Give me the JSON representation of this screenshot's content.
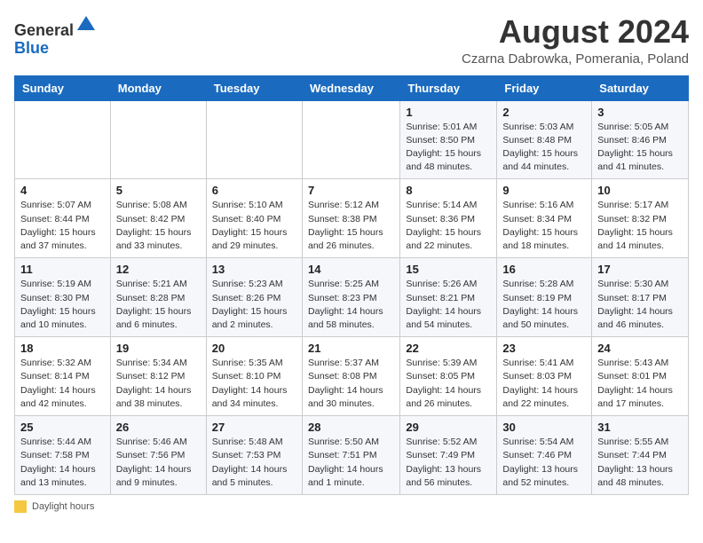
{
  "header": {
    "logo_line1": "General",
    "logo_line2": "Blue",
    "title": "August 2024",
    "subtitle": "Czarna Dabrowka, Pomerania, Poland"
  },
  "days_of_week": [
    "Sunday",
    "Monday",
    "Tuesday",
    "Wednesday",
    "Thursday",
    "Friday",
    "Saturday"
  ],
  "weeks": [
    [
      {
        "day": "",
        "info": ""
      },
      {
        "day": "",
        "info": ""
      },
      {
        "day": "",
        "info": ""
      },
      {
        "day": "",
        "info": ""
      },
      {
        "day": "1",
        "info": "Sunrise: 5:01 AM\nSunset: 8:50 PM\nDaylight: 15 hours\nand 48 minutes."
      },
      {
        "day": "2",
        "info": "Sunrise: 5:03 AM\nSunset: 8:48 PM\nDaylight: 15 hours\nand 44 minutes."
      },
      {
        "day": "3",
        "info": "Sunrise: 5:05 AM\nSunset: 8:46 PM\nDaylight: 15 hours\nand 41 minutes."
      }
    ],
    [
      {
        "day": "4",
        "info": "Sunrise: 5:07 AM\nSunset: 8:44 PM\nDaylight: 15 hours\nand 37 minutes."
      },
      {
        "day": "5",
        "info": "Sunrise: 5:08 AM\nSunset: 8:42 PM\nDaylight: 15 hours\nand 33 minutes."
      },
      {
        "day": "6",
        "info": "Sunrise: 5:10 AM\nSunset: 8:40 PM\nDaylight: 15 hours\nand 29 minutes."
      },
      {
        "day": "7",
        "info": "Sunrise: 5:12 AM\nSunset: 8:38 PM\nDaylight: 15 hours\nand 26 minutes."
      },
      {
        "day": "8",
        "info": "Sunrise: 5:14 AM\nSunset: 8:36 PM\nDaylight: 15 hours\nand 22 minutes."
      },
      {
        "day": "9",
        "info": "Sunrise: 5:16 AM\nSunset: 8:34 PM\nDaylight: 15 hours\nand 18 minutes."
      },
      {
        "day": "10",
        "info": "Sunrise: 5:17 AM\nSunset: 8:32 PM\nDaylight: 15 hours\nand 14 minutes."
      }
    ],
    [
      {
        "day": "11",
        "info": "Sunrise: 5:19 AM\nSunset: 8:30 PM\nDaylight: 15 hours\nand 10 minutes."
      },
      {
        "day": "12",
        "info": "Sunrise: 5:21 AM\nSunset: 8:28 PM\nDaylight: 15 hours\nand 6 minutes."
      },
      {
        "day": "13",
        "info": "Sunrise: 5:23 AM\nSunset: 8:26 PM\nDaylight: 15 hours\nand 2 minutes."
      },
      {
        "day": "14",
        "info": "Sunrise: 5:25 AM\nSunset: 8:23 PM\nDaylight: 14 hours\nand 58 minutes."
      },
      {
        "day": "15",
        "info": "Sunrise: 5:26 AM\nSunset: 8:21 PM\nDaylight: 14 hours\nand 54 minutes."
      },
      {
        "day": "16",
        "info": "Sunrise: 5:28 AM\nSunset: 8:19 PM\nDaylight: 14 hours\nand 50 minutes."
      },
      {
        "day": "17",
        "info": "Sunrise: 5:30 AM\nSunset: 8:17 PM\nDaylight: 14 hours\nand 46 minutes."
      }
    ],
    [
      {
        "day": "18",
        "info": "Sunrise: 5:32 AM\nSunset: 8:14 PM\nDaylight: 14 hours\nand 42 minutes."
      },
      {
        "day": "19",
        "info": "Sunrise: 5:34 AM\nSunset: 8:12 PM\nDaylight: 14 hours\nand 38 minutes."
      },
      {
        "day": "20",
        "info": "Sunrise: 5:35 AM\nSunset: 8:10 PM\nDaylight: 14 hours\nand 34 minutes."
      },
      {
        "day": "21",
        "info": "Sunrise: 5:37 AM\nSunset: 8:08 PM\nDaylight: 14 hours\nand 30 minutes."
      },
      {
        "day": "22",
        "info": "Sunrise: 5:39 AM\nSunset: 8:05 PM\nDaylight: 14 hours\nand 26 minutes."
      },
      {
        "day": "23",
        "info": "Sunrise: 5:41 AM\nSunset: 8:03 PM\nDaylight: 14 hours\nand 22 minutes."
      },
      {
        "day": "24",
        "info": "Sunrise: 5:43 AM\nSunset: 8:01 PM\nDaylight: 14 hours\nand 17 minutes."
      }
    ],
    [
      {
        "day": "25",
        "info": "Sunrise: 5:44 AM\nSunset: 7:58 PM\nDaylight: 14 hours\nand 13 minutes."
      },
      {
        "day": "26",
        "info": "Sunrise: 5:46 AM\nSunset: 7:56 PM\nDaylight: 14 hours\nand 9 minutes."
      },
      {
        "day": "27",
        "info": "Sunrise: 5:48 AM\nSunset: 7:53 PM\nDaylight: 14 hours\nand 5 minutes."
      },
      {
        "day": "28",
        "info": "Sunrise: 5:50 AM\nSunset: 7:51 PM\nDaylight: 14 hours\nand 1 minute."
      },
      {
        "day": "29",
        "info": "Sunrise: 5:52 AM\nSunset: 7:49 PM\nDaylight: 13 hours\nand 56 minutes."
      },
      {
        "day": "30",
        "info": "Sunrise: 5:54 AM\nSunset: 7:46 PM\nDaylight: 13 hours\nand 52 minutes."
      },
      {
        "day": "31",
        "info": "Sunrise: 5:55 AM\nSunset: 7:44 PM\nDaylight: 13 hours\nand 48 minutes."
      }
    ]
  ],
  "footer": {
    "daylight_label": "Daylight hours"
  }
}
